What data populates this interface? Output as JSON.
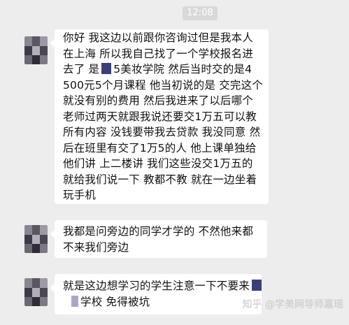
{
  "header": {
    "timestamp": "12:08"
  },
  "messages": [
    {
      "lines": [
        "你好 我这边以前跟你咨询过但是我本人",
        "在上海 所以我自己找了一个学校报名进",
        "去了 是",
        "5美妆学院 然后当时交的是4",
        "500元5个月课程 他当初说的是 交完这个",
        "就没有别的费用 然后我进来了以后哪个",
        "老师过两天就跟我说还要交1万五可以教",
        "所有内容 没钱要带我去贷款 我没同意 然",
        "后在班里有交了1万5的人 他上课单独给",
        "他们讲 上二楼讲 我们这些没交1万五的",
        "就给我们说一下 教都不教 就在一边坐着",
        "玩手机"
      ]
    },
    {
      "lines": [
        "我都是问旁边的同学才学的 不然他来都",
        "不来我们旁边"
      ]
    },
    {
      "lines": [
        "就是这边想学习的学生注意一下不要来",
        "学校 免得被坑"
      ]
    }
  ],
  "watermark": "知乎 @学美网导师嘉瑶"
}
